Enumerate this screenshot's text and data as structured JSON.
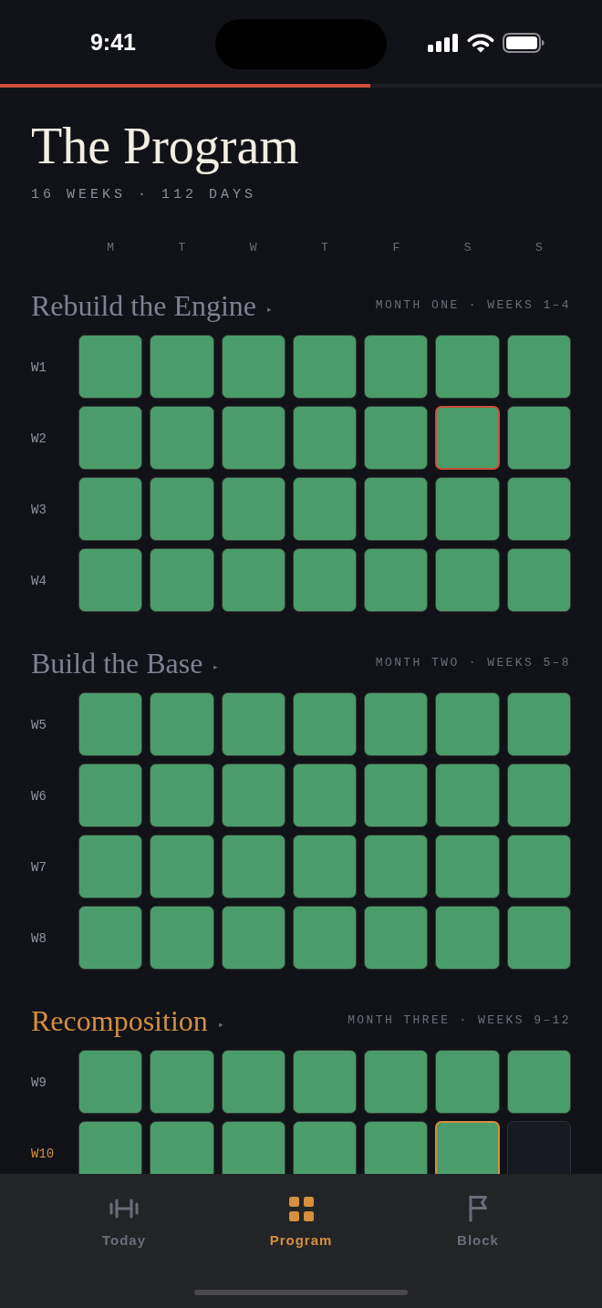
{
  "status_bar": {
    "time": "9:41"
  },
  "progress": {
    "level": 0.615
  },
  "header": {
    "title": "The Program",
    "subtitle": "16 WEEKS · 112 DAYS"
  },
  "weekdays": [
    "M",
    "T",
    "W",
    "T",
    "F",
    "S",
    "S"
  ],
  "months": [
    {
      "title": "Rebuild the Engine",
      "marker": "▸",
      "meta": "MONTH ONE · WEEKS 1–4",
      "current": false,
      "weeks": [
        {
          "label": "W1",
          "current": false,
          "days": [
            {
              "kind": "done"
            },
            {
              "kind": "done"
            },
            {
              "kind": "done"
            },
            {
              "kind": "done"
            },
            {
              "kind": "done"
            },
            {
              "kind": "done"
            },
            {
              "kind": "done"
            }
          ]
        },
        {
          "label": "W2",
          "current": false,
          "days": [
            {
              "kind": "done"
            },
            {
              "kind": "done"
            },
            {
              "kind": "done"
            },
            {
              "kind": "done"
            },
            {
              "kind": "done"
            },
            {
              "kind": "marked"
            },
            {
              "kind": "done"
            }
          ]
        },
        {
          "label": "W3",
          "current": false,
          "days": [
            {
              "kind": "done"
            },
            {
              "kind": "done"
            },
            {
              "kind": "done"
            },
            {
              "kind": "done"
            },
            {
              "kind": "done"
            },
            {
              "kind": "done"
            },
            {
              "kind": "done"
            }
          ]
        },
        {
          "label": "W4",
          "current": false,
          "days": [
            {
              "kind": "done"
            },
            {
              "kind": "done"
            },
            {
              "kind": "done"
            },
            {
              "kind": "done"
            },
            {
              "kind": "done"
            },
            {
              "kind": "done"
            },
            {
              "kind": "done"
            }
          ]
        }
      ]
    },
    {
      "title": "Build the Base",
      "marker": "▸",
      "meta": "MONTH TWO · WEEKS 5–8",
      "current": false,
      "weeks": [
        {
          "label": "W5",
          "current": false,
          "days": [
            {
              "kind": "done"
            },
            {
              "kind": "done"
            },
            {
              "kind": "done"
            },
            {
              "kind": "done"
            },
            {
              "kind": "done"
            },
            {
              "kind": "done"
            },
            {
              "kind": "done"
            }
          ]
        },
        {
          "label": "W6",
          "current": false,
          "days": [
            {
              "kind": "done"
            },
            {
              "kind": "done"
            },
            {
              "kind": "done"
            },
            {
              "kind": "done"
            },
            {
              "kind": "done"
            },
            {
              "kind": "done"
            },
            {
              "kind": "done"
            }
          ]
        },
        {
          "label": "W7",
          "current": false,
          "days": [
            {
              "kind": "done"
            },
            {
              "kind": "done"
            },
            {
              "kind": "done"
            },
            {
              "kind": "done"
            },
            {
              "kind": "done"
            },
            {
              "kind": "done"
            },
            {
              "kind": "done"
            }
          ]
        },
        {
          "label": "W8",
          "current": false,
          "days": [
            {
              "kind": "done"
            },
            {
              "kind": "done"
            },
            {
              "kind": "done"
            },
            {
              "kind": "done"
            },
            {
              "kind": "done"
            },
            {
              "kind": "done"
            },
            {
              "kind": "done"
            }
          ]
        }
      ]
    },
    {
      "title": "Recomposition",
      "marker": "▸",
      "meta": "MONTH THREE · WEEKS 9–12",
      "current": true,
      "weeks": [
        {
          "label": "W9",
          "current": false,
          "days": [
            {
              "kind": "done"
            },
            {
              "kind": "done"
            },
            {
              "kind": "done"
            },
            {
              "kind": "done"
            },
            {
              "kind": "done"
            },
            {
              "kind": "done"
            },
            {
              "kind": "done"
            }
          ]
        },
        {
          "label": "W10",
          "current": true,
          "days": [
            {
              "kind": "done"
            },
            {
              "kind": "done"
            },
            {
              "kind": "done"
            },
            {
              "kind": "done"
            },
            {
              "kind": "done"
            },
            {
              "kind": "today"
            },
            {
              "kind": "upcoming"
            }
          ]
        }
      ]
    }
  ],
  "tab_bar": {
    "tabs": [
      {
        "label": "Today",
        "selected": false
      },
      {
        "label": "Program",
        "selected": true
      },
      {
        "label": "Block",
        "selected": false
      }
    ]
  }
}
